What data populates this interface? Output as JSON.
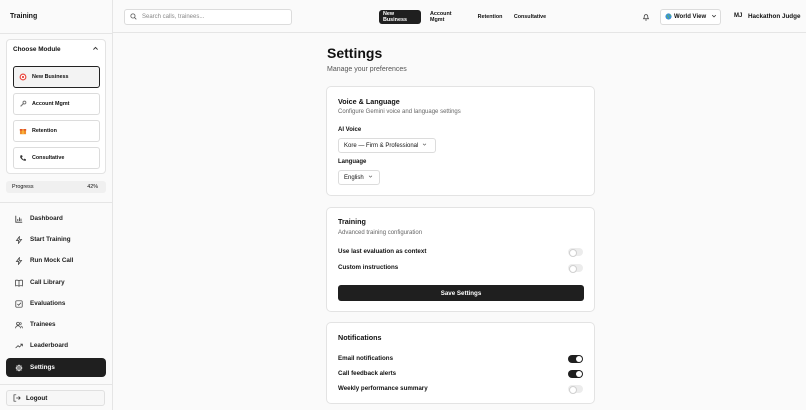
{
  "app": {
    "title": "Training"
  },
  "module": {
    "heading": "Choose Module",
    "items": [
      {
        "label": "New Business",
        "icon": "target-icon"
      },
      {
        "label": "Account Mgmt",
        "icon": "wrench-icon"
      },
      {
        "label": "Retention",
        "icon": "gift-icon"
      },
      {
        "label": "Consultative",
        "icon": "phone-icon"
      }
    ],
    "selected": "New Business"
  },
  "progress": {
    "label": "Progress",
    "value": "42%"
  },
  "nav": {
    "items": [
      {
        "label": "Dashboard",
        "icon": "bar-chart-icon"
      },
      {
        "label": "Start Training",
        "icon": "bolt-icon"
      },
      {
        "label": "Run Mock Call",
        "icon": "bolt-icon"
      },
      {
        "label": "Call Library",
        "icon": "book-icon"
      },
      {
        "label": "Evaluations",
        "icon": "checkbox-icon"
      },
      {
        "label": "Trainees",
        "icon": "users-icon"
      },
      {
        "label": "Leaderboard",
        "icon": "trend-icon"
      },
      {
        "label": "Settings",
        "icon": "gear-icon"
      }
    ],
    "active": "Settings",
    "logout": "Logout"
  },
  "topbar": {
    "search_placeholder": "Search calls, trainees...",
    "tabs": [
      "New Business",
      "Account Mgmt",
      "Retention",
      "Consultative"
    ],
    "active_tab": "New Business",
    "region": "World View",
    "user_initials": "MJ",
    "user_name": "Hackathon Judge"
  },
  "page": {
    "title": "Settings",
    "subtitle": "Manage your preferences"
  },
  "voice": {
    "title": "Voice & Language",
    "subtitle": "Configure Gemini voice and language settings",
    "voice_label": "AI Voice",
    "voice_value": "Kore — Firm & Professional",
    "language_label": "Language",
    "language_value": "English"
  },
  "training": {
    "title": "Training",
    "subtitle": "Advanced training configuration",
    "options": [
      {
        "label": "Use last evaluation as context",
        "enabled": false
      },
      {
        "label": "Custom instructions",
        "enabled": false
      }
    ],
    "save_label": "Save Settings"
  },
  "notifications": {
    "title": "Notifications",
    "options": [
      {
        "label": "Email notifications",
        "enabled": true
      },
      {
        "label": "Call feedback alerts",
        "enabled": true
      },
      {
        "label": "Weekly performance summary",
        "enabled": false
      }
    ]
  },
  "colors": {
    "accent": "#1f1f1f",
    "background": "#fafafa",
    "card": "#ffffff"
  }
}
